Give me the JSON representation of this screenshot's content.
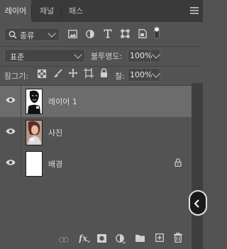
{
  "tabs": [
    {
      "label": "레이어"
    },
    {
      "label": "채널"
    },
    {
      "label": "패스"
    }
  ],
  "filter": {
    "kind_label": "종류",
    "icons": [
      "image-filter-icon",
      "adjustment-filter-icon",
      "type-filter-icon",
      "shape-filter-icon",
      "smart-object-filter-icon",
      "filter-toggle-icon"
    ]
  },
  "blend": {
    "mode": "표준",
    "opacity_label": "불투명도:",
    "opacity_value": "100%"
  },
  "lock": {
    "label": "잠그기:",
    "fill_label": "칠:",
    "fill_value": "100%",
    "icons": [
      "lock-transparent-pixels-icon",
      "lock-image-pixels-icon",
      "lock-position-icon",
      "lock-artboard-icon",
      "lock-all-icon"
    ]
  },
  "layers": [
    {
      "name": "레이어 1",
      "selected": true,
      "visible": true
    },
    {
      "name": "사진",
      "selected": false,
      "visible": true
    },
    {
      "name": "배경",
      "selected": false,
      "visible": true,
      "locked": true
    }
  ],
  "bottom_icons": [
    "link-layers-icon",
    "fx-icon",
    "add-mask-icon",
    "new-adjustment-layer-icon",
    "new-group-icon",
    "new-layer-icon",
    "delete-layer-icon"
  ],
  "colors": {
    "panel_bg": "#535353",
    "tabbar_bg": "#3a3a3a",
    "selected_layer_bg": "#6c6c6c"
  }
}
